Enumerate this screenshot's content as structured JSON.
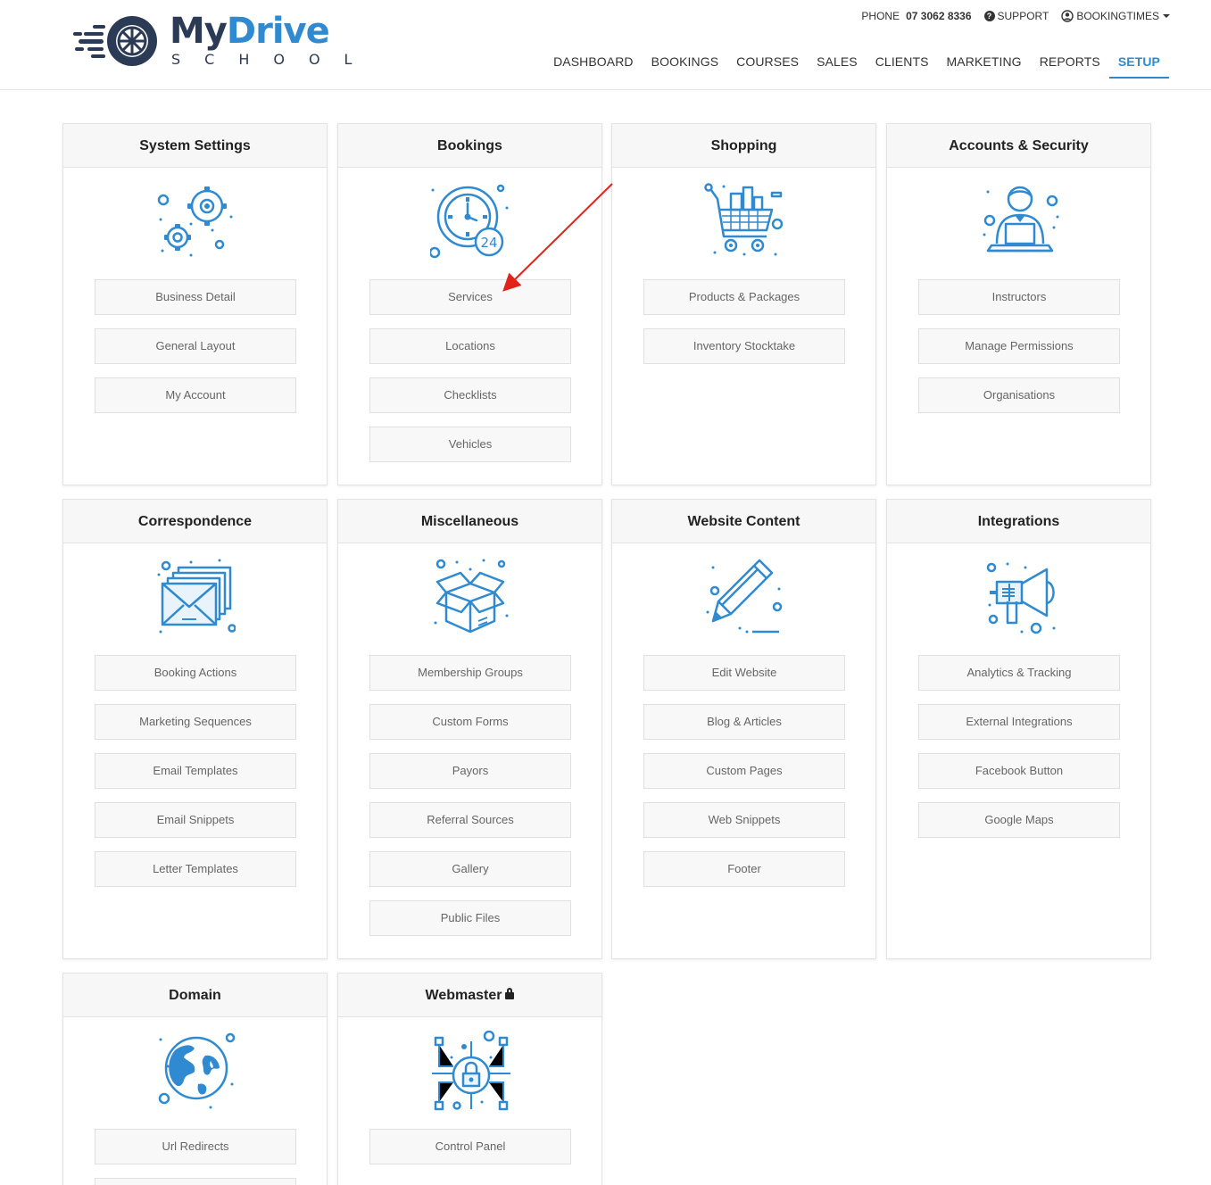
{
  "brand": {
    "logo_my": "My",
    "logo_drive": "Drive",
    "logo_school": "SCHOOL"
  },
  "topbar": {
    "phone_label": "PHONE",
    "phone_number": "07 3062 8336",
    "support_label": "SUPPORT",
    "account_label": "BOOKINGTIMES"
  },
  "nav": {
    "items": [
      "DASHBOARD",
      "BOOKINGS",
      "COURSES",
      "SALES",
      "CLIENTS",
      "MARKETING",
      "REPORTS",
      "SETUP"
    ],
    "active": "SETUP"
  },
  "colors": {
    "accent": "#2f8ad1",
    "logo_dark": "#2b3a55",
    "annotation_arrow": "#e0241b"
  },
  "cards": [
    {
      "title": "System Settings",
      "icon": "gears-icon",
      "buttons": [
        "Business Detail",
        "General Layout",
        "My Account"
      ]
    },
    {
      "title": "Bookings",
      "icon": "clock-24-icon",
      "buttons": [
        "Services",
        "Locations",
        "Checklists",
        "Vehicles"
      ]
    },
    {
      "title": "Shopping",
      "icon": "shopping-cart-icon",
      "buttons": [
        "Products & Packages",
        "Inventory Stocktake"
      ]
    },
    {
      "title": "Accounts & Security",
      "icon": "user-laptop-icon",
      "buttons": [
        "Instructors",
        "Manage Permissions",
        "Organisations"
      ]
    },
    {
      "title": "Correspondence",
      "icon": "envelopes-icon",
      "buttons": [
        "Booking Actions",
        "Marketing Sequences",
        "Email Templates",
        "Email Snippets",
        "Letter Templates"
      ]
    },
    {
      "title": "Miscellaneous",
      "icon": "open-box-icon",
      "buttons": [
        "Membership Groups",
        "Custom Forms",
        "Payors",
        "Referral Sources",
        "Gallery",
        "Public Files"
      ]
    },
    {
      "title": "Website Content",
      "icon": "pencil-icon",
      "buttons": [
        "Edit Website",
        "Blog & Articles",
        "Custom Pages",
        "Web Snippets",
        "Footer"
      ]
    },
    {
      "title": "Integrations",
      "icon": "megaphone-icon",
      "buttons": [
        "Analytics & Tracking",
        "External Integrations",
        "Facebook Button",
        "Google Maps"
      ]
    },
    {
      "title": "Domain",
      "icon": "globe-icon",
      "buttons": [
        "Url Redirects"
      ]
    },
    {
      "title": "Webmaster",
      "icon": "lock-circuit-icon",
      "buttons": [
        "Control Panel"
      ]
    }
  ]
}
